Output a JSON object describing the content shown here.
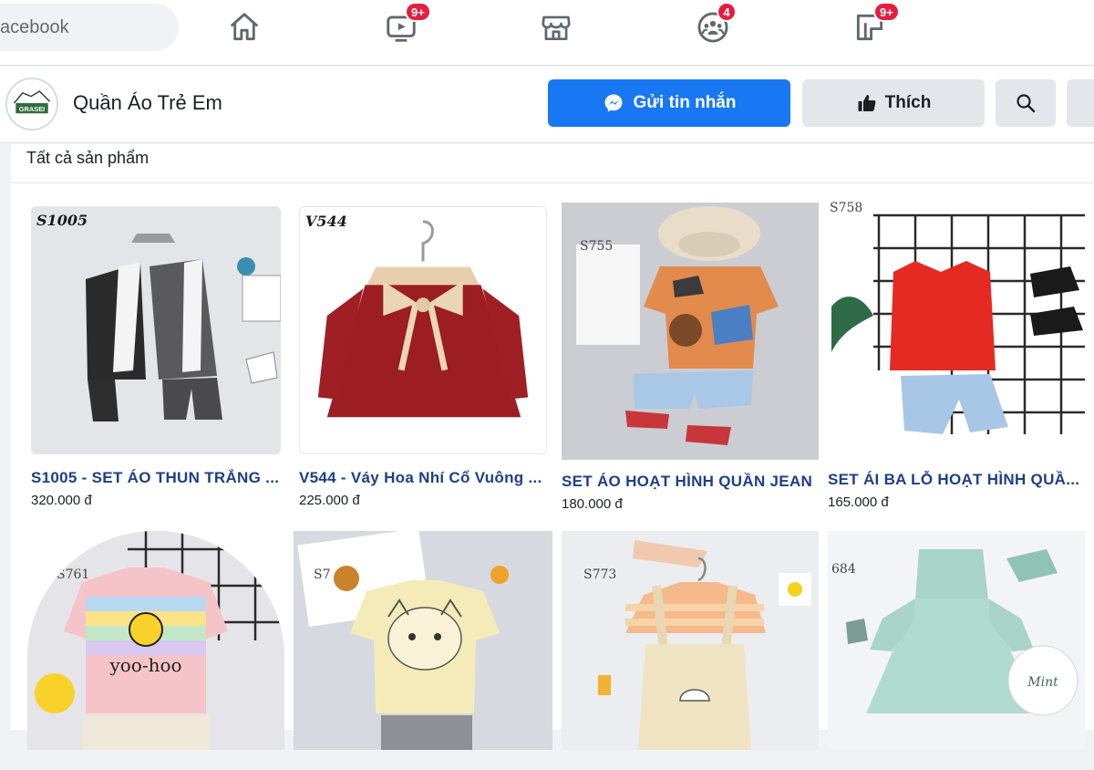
{
  "topnav": {
    "search_text": "acebook",
    "video_badge": "9+",
    "groups_badge": "4",
    "gaming_badge": "9+"
  },
  "page": {
    "name": "Quần Áo Trẻ Em",
    "avatar_text": "GRASEI",
    "message_label": "Gửi tin nhắn",
    "like_label": "Thích"
  },
  "section_title": "Tất cả sản phẩm",
  "products": [
    {
      "code": "S1005",
      "title": "S1005 - SET ÁO THUN TRẮNG ...",
      "price": "320.000 đ"
    },
    {
      "code": "V544",
      "title": "V544 - Váy Hoa Nhí Cổ Vuông ...",
      "price": "225.000 đ"
    },
    {
      "code": "S755",
      "title": "SET ÁO HOẠT HÌNH QUẦN JEAN",
      "price": "180.000 đ"
    },
    {
      "code": "S758",
      "title": "SET ÁI BA LỖ HOẠT HÌNH QUẦ...",
      "price": "165.000 đ"
    },
    {
      "code": "S761",
      "title": "",
      "price": ""
    },
    {
      "code": "S7",
      "title": "",
      "price": ""
    },
    {
      "code": "S773",
      "title": "",
      "price": ""
    },
    {
      "code": "684",
      "title": "",
      "price": ""
    }
  ],
  "colors": {
    "accent": "#1877f2",
    "badge": "#e41e3f",
    "product_title": "#1c3f8a"
  }
}
